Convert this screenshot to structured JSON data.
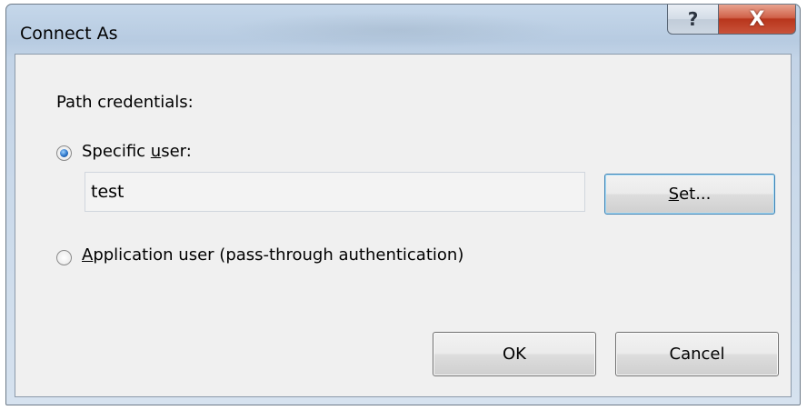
{
  "window": {
    "title": "Connect As",
    "help_glyph": "?",
    "close_glyph": "X"
  },
  "path_credentials": {
    "label": "Path credentials:"
  },
  "specific_user": {
    "label_before": "Specific ",
    "label_access_key": "u",
    "label_after": "ser:",
    "selected": true,
    "value": "test"
  },
  "set_button": {
    "access_key": "S",
    "label_after": "et..."
  },
  "application_user": {
    "access_key": "A",
    "label_after": "pplication user (pass-through authentication)",
    "selected": false
  },
  "buttons": {
    "ok": "OK",
    "cancel": "Cancel"
  },
  "icons": {
    "help": "help-icon",
    "close": "close-icon"
  }
}
